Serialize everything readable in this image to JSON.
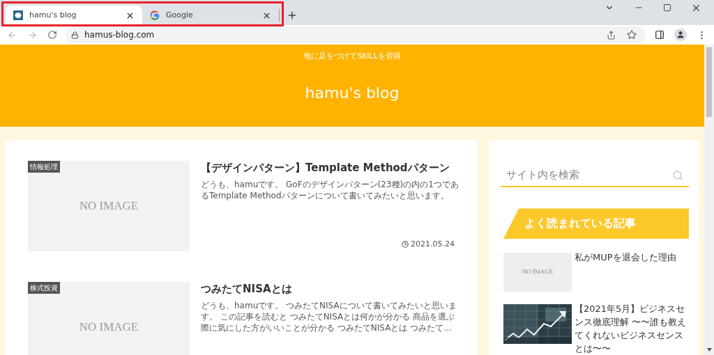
{
  "browser": {
    "tabs": [
      {
        "title": "hamu's blog",
        "selected": true
      },
      {
        "title": "Google",
        "selected": false
      }
    ],
    "url": "hamus-blog.com"
  },
  "site": {
    "tagline": "地に足をつけてSKILLを習得",
    "title": "hamu's blog"
  },
  "posts": [
    {
      "category": "情報処理",
      "thumbnail_text": "NO IMAGE",
      "title": "【デザインパターン】Template Methodパターン",
      "excerpt": "どうも、hamuです。 GoFのデザインパターン(23種)の内の1つであるTemplate Methodパターンについて書いてみたいと思います。",
      "date": "2021.05.24"
    },
    {
      "category": "株式投資",
      "thumbnail_text": "NO IMAGE",
      "title": "つみたてNISAとは",
      "excerpt": "どうも、hamuです。 つみたてNISAについて書いてみたいと思います。 この記事を読むと つみたてNISAとは何かが分かる 商品を選ぶ際に気にした方がいいことが分かる つみたてNISAとは つみたて…"
    }
  ],
  "sidebar": {
    "search": {
      "placeholder": "サイト内を検索"
    },
    "popular_heading": "よく読まれている記事",
    "popular": [
      {
        "title": "私がMUPを退会した理由",
        "thumbnail": {
          "kind": "no_image",
          "text": "NO IMAGE"
        }
      },
      {
        "title": "【2021年5月】ビジネスセンス徹底理解 〜〜誰も教えてくれないビジネスセンスとは〜〜"
      }
    ]
  }
}
